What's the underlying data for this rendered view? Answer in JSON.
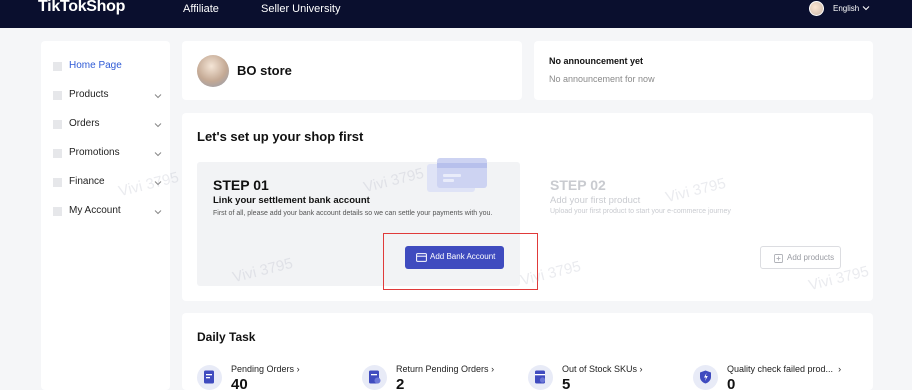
{
  "header": {
    "brand": "TikTokShop",
    "nav": [
      {
        "label": "Affiliate"
      },
      {
        "label": "Seller University"
      }
    ],
    "language": "English"
  },
  "sidebar": {
    "items": [
      {
        "label": "Home Page",
        "active": true,
        "expandable": false
      },
      {
        "label": "Products",
        "active": false,
        "expandable": true
      },
      {
        "label": "Orders",
        "active": false,
        "expandable": true
      },
      {
        "label": "Promotions",
        "active": false,
        "expandable": true
      },
      {
        "label": "Finance",
        "active": false,
        "expandable": true
      },
      {
        "label": "My Account",
        "active": false,
        "expandable": true
      }
    ]
  },
  "store": {
    "name": "BO store"
  },
  "announcement": {
    "title": "No announcement yet",
    "text": "No announcement for now"
  },
  "setup": {
    "title": "Let's set up your shop first",
    "step1": {
      "number": "STEP 01",
      "title": "Link your settlement bank account",
      "description": "First of all, please add your bank account details so we can settle your payments with you.",
      "button": "Add Bank Account"
    },
    "step2": {
      "number": "STEP 02",
      "title": "Add your first product",
      "description": "Upload your first product to start your e-commerce journey",
      "button": "Add products"
    }
  },
  "daily": {
    "title": "Daily Task",
    "tasks": [
      {
        "label": "Pending Orders",
        "value": "40",
        "icon": "document-icon"
      },
      {
        "label": "Return Pending Orders",
        "value": "2",
        "icon": "return-document-icon"
      },
      {
        "label": "Out of Stock SKUs",
        "value": "5",
        "icon": "stock-alert-icon"
      },
      {
        "label": "Quality check failed prod...",
        "value": "0",
        "icon": "quality-check-icon"
      }
    ]
  },
  "watermark": "Vivi 3795",
  "colors": {
    "topbar": "#0a0f2e",
    "primary_button": "#3f4bbf",
    "active_nav": "#2f5bd6",
    "highlight": "#e03a3a"
  }
}
